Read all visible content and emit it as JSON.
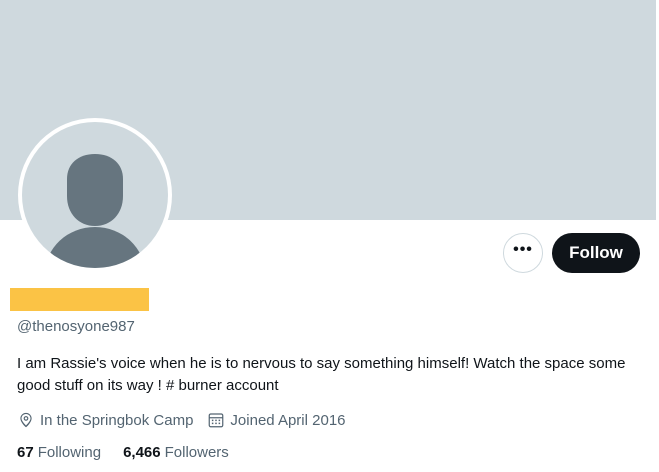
{
  "profile": {
    "handle": "@thenosyone987",
    "bio": "I am Rassie's voice when he is to nervous to say something himself! Watch the space some good stuff on its way ! # burner account",
    "location": "In the Springbok Camp",
    "joined": "Joined April 2016",
    "name_redaction_color": "#fbc345"
  },
  "actions": {
    "more_label": "•••",
    "follow_label": "Follow"
  },
  "stats": {
    "following_count": "67",
    "following_label": "Following",
    "followers_count": "6,466",
    "followers_label": "Followers"
  },
  "icons": {
    "location": "location-pin-icon",
    "calendar": "calendar-icon",
    "more": "more-dots-icon"
  },
  "colors": {
    "banner": "#cfd9de",
    "avatar_silhouette": "#66757f",
    "follow_button": "#0f1419",
    "secondary_text": "#536471"
  }
}
